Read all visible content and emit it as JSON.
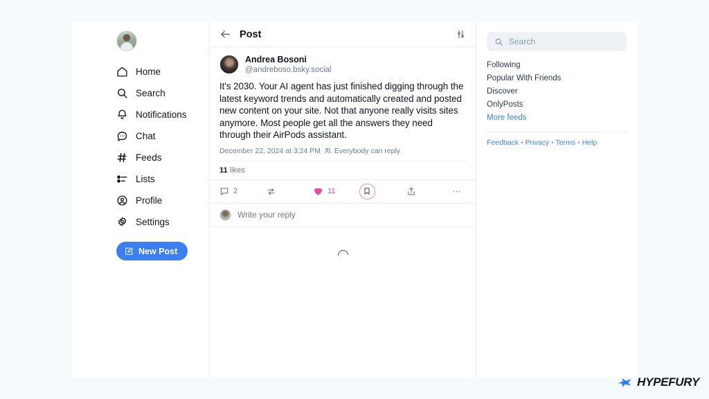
{
  "app": {
    "background_color": "#f5fafd",
    "card_background": "#ffffff",
    "accent_color": "#3b7ff2",
    "like_color": "#ec4899",
    "bookmark_highlight_color": "#f0938c"
  },
  "sidebar": {
    "avatar_name": "user-avatar",
    "items": [
      {
        "label": "Home",
        "icon": "home-icon"
      },
      {
        "label": "Search",
        "icon": "search-icon"
      },
      {
        "label": "Notifications",
        "icon": "bell-icon"
      },
      {
        "label": "Chat",
        "icon": "chat-bubble-icon"
      },
      {
        "label": "Feeds",
        "icon": "hashtag-icon"
      },
      {
        "label": "Lists",
        "icon": "list-icon"
      },
      {
        "label": "Profile",
        "icon": "person-circle-icon"
      },
      {
        "label": "Settings",
        "icon": "gear-icon"
      }
    ],
    "new_post_label": "New Post",
    "new_post_icon": "compose-icon"
  },
  "center": {
    "header": {
      "back_icon": "back-arrow-icon",
      "title": "Post",
      "filter_icon": "sliders-icon"
    },
    "post": {
      "author_name": "Andrea Bosoni",
      "author_handle": "@andreboso.bsky.social",
      "text": "It's 2030. Your AI agent has just finished digging through the latest keyword trends and automatically created and posted new content on your site. Not that anyone really visits sites anymore. Most people get all the answers they need through their AirPods assistant.",
      "timestamp": "December 22, 2024 at 3:24 PM",
      "reply_scope_icon": "people-icon",
      "reply_scope": "Everybody can reply",
      "likes_count": "11",
      "likes_label": "likes"
    },
    "actions": [
      {
        "name": "reply-action",
        "icon": "comment-icon",
        "count": "2",
        "active": false
      },
      {
        "name": "repost-action",
        "icon": "repost-icon",
        "count": "",
        "active": false
      },
      {
        "name": "like-action",
        "icon": "heart-icon",
        "count": "11",
        "active": true
      },
      {
        "name": "bookmark-action",
        "icon": "bookmark-icon",
        "count": "",
        "active": false
      },
      {
        "name": "share-action",
        "icon": "share-icon",
        "count": "",
        "active": false
      },
      {
        "name": "more-action",
        "icon": "ellipsis-icon",
        "count": "",
        "active": false
      }
    ],
    "reply_composer": {
      "placeholder": "Write your reply",
      "avatar": "reply-avatar"
    },
    "loading": "spinner"
  },
  "right": {
    "search": {
      "placeholder": "Search",
      "icon": "search-icon"
    },
    "feeds": [
      {
        "label": "Following",
        "highlight": false
      },
      {
        "label": "Popular With Friends",
        "highlight": false
      },
      {
        "label": "Discover",
        "highlight": false
      },
      {
        "label": "OnlyPosts",
        "highlight": false
      },
      {
        "label": "More feeds",
        "highlight": true
      }
    ],
    "footer_links": [
      "Feedback",
      "Privacy",
      "Terms",
      "Help"
    ],
    "footer_separator": "•"
  },
  "watermark": {
    "brand": "HYPEFURY",
    "icon": "hypefury-bird-icon",
    "icon_color": "#2b7fff"
  }
}
